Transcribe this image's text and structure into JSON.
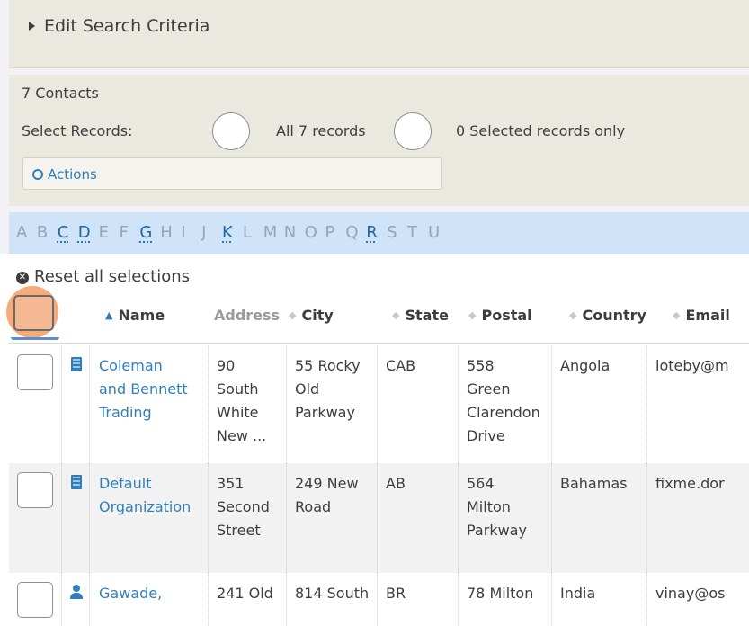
{
  "search_panel": {
    "toggle_label": "Edit Search Criteria"
  },
  "results": {
    "count_label": "7 Contacts",
    "select_records_label": "Select Records:",
    "option_all": "All 7 records",
    "option_selected": "0 Selected records only",
    "actions_label": "Actions"
  },
  "alphabet": {
    "letters": [
      "A",
      "B",
      "C",
      "D",
      "E",
      "F",
      "G",
      "H",
      "I",
      "J",
      "K",
      "L",
      "M",
      "N",
      "O",
      "P",
      "Q",
      "R",
      "S",
      "T",
      "U"
    ],
    "active": [
      "C",
      "D",
      "G",
      "K",
      "R"
    ]
  },
  "grid": {
    "reset_label": "Reset all selections",
    "headers": {
      "name": "Name",
      "address": "Address",
      "city": "City",
      "state": "State",
      "postal": "Postal",
      "country": "Country",
      "email": "Email"
    },
    "rows": [
      {
        "type_icon": "building-icon",
        "name": "Coleman\nand Bennett\nTrading",
        "address": "90\nSouth\nWhite\nNew ...",
        "city": "55 Rocky\nOld\nParkway",
        "state": "CAB",
        "postal": "558\nGreen\nClarendon\nDrive",
        "country": "Angola",
        "email": "loteby@m"
      },
      {
        "type_icon": "building-icon",
        "name": "Default\nOrganization",
        "address": "351\nSecond\nStreet",
        "city": "249 New\nRoad",
        "state": "AB",
        "postal": "564\nMilton\nParkway",
        "country": "Bahamas",
        "email": "fixme.dor"
      },
      {
        "type_icon": "person-icon",
        "name": "Gawade,",
        "address": "241 Old",
        "city": "814 South",
        "state": "BR",
        "postal": "78 Milton",
        "country": "India",
        "email": "vinay@os"
      }
    ]
  }
}
